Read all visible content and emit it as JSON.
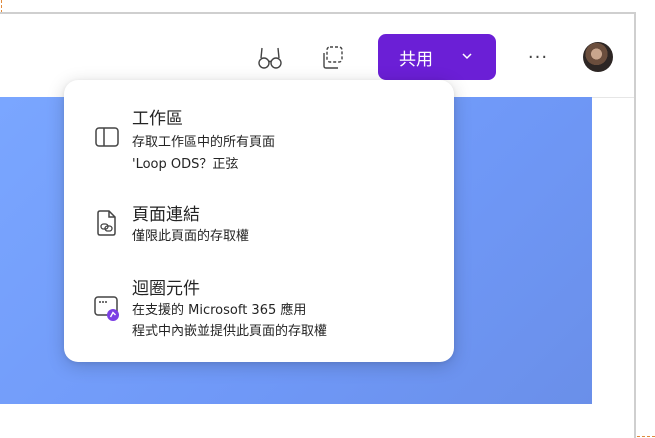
{
  "toolbar": {
    "icons": [
      "glasses-icon",
      "copy-link-icon"
    ],
    "share_label": "共用",
    "more_label": "···",
    "avatar": "user-avatar"
  },
  "menu": {
    "items": [
      {
        "title": "工作區",
        "desc_line1": "存取工作區中的所有頁面",
        "desc_line2": "'Loop ODS？正弦",
        "icon": "workspace-panel-icon"
      },
      {
        "title": "頁面連結",
        "desc_line1": "僅限此頁面的存取權",
        "desc_line2": "",
        "icon": "page-link-icon"
      },
      {
        "title": "迴圈元件",
        "desc_line1": "在支援的 Microsoft 365 應用",
        "desc_line2": "程式中內嵌並提供此頁面的存取權",
        "icon": "loop-component-icon"
      }
    ]
  },
  "colors": {
    "accent": "#6b1fd6",
    "canvas": "#7aa6ff"
  }
}
